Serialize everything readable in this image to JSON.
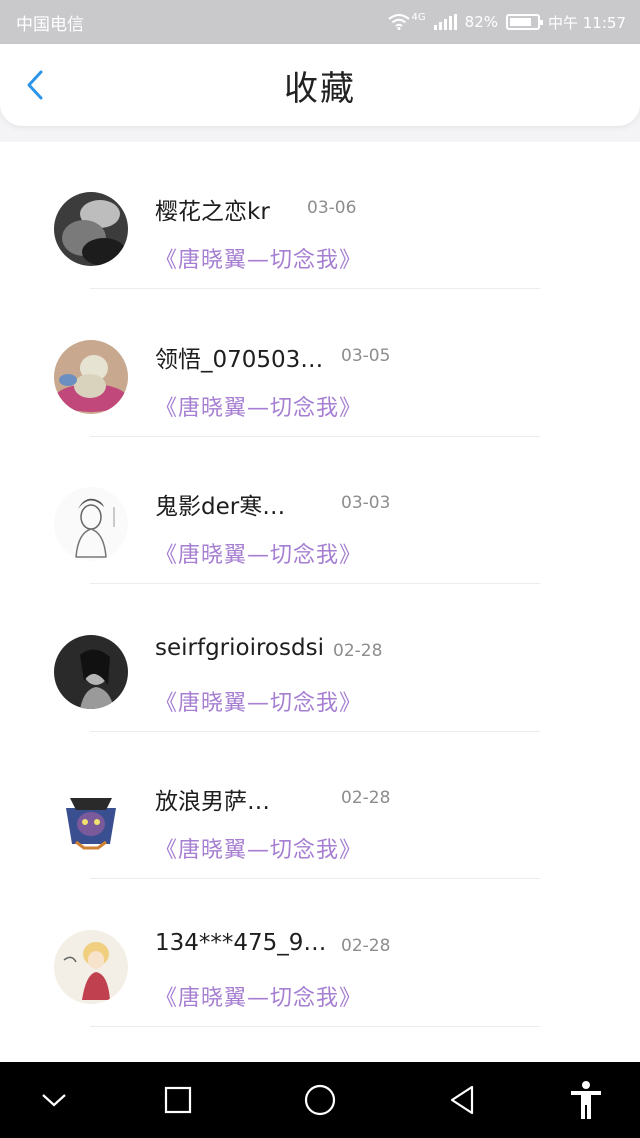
{
  "status_bar": {
    "carrier": "中国电信",
    "network": "4G",
    "battery_text": "82%",
    "battery_level": 0.82,
    "time": "中午 11:57"
  },
  "header": {
    "title": "收藏",
    "back_icon": "chevron-left-icon",
    "accent": "#2d95e8"
  },
  "favorites": [
    {
      "name": "樱花之恋kr",
      "date": "03-06",
      "title": "《唐晓翼—切念我》"
    },
    {
      "name": "领悟_070503…",
      "date": "03-05",
      "title": "《唐晓翼—切念我》"
    },
    {
      "name": "鬼影der寒…",
      "date": "03-03",
      "title": "《唐晓翼—切念我》"
    },
    {
      "name": "seirfgrioirosdsi",
      "date": "02-28",
      "title": "《唐晓翼—切念我》"
    },
    {
      "name": "放浪男萨…",
      "date": "02-28",
      "title": "《唐晓翼—切念我》"
    },
    {
      "name": "134***475_9…",
      "date": "02-28",
      "title": "《唐晓翼—切念我》"
    }
  ],
  "title_color": "#a67fd2",
  "nav_bar": {
    "icons": [
      "chevron-down-icon",
      "square-recents-icon",
      "circle-home-icon",
      "triangle-back-icon",
      "accessibility-icon"
    ]
  }
}
